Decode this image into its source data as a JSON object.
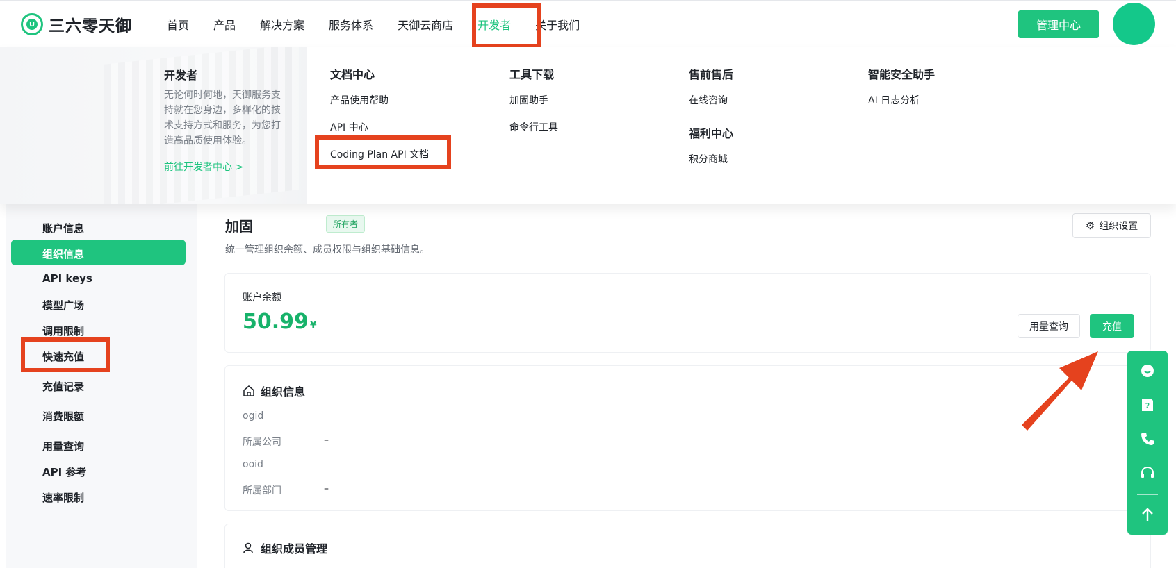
{
  "brand": {
    "name": "三六零天御"
  },
  "nav": {
    "items": [
      "首页",
      "产品",
      "解决方案",
      "服务体系",
      "天御云商店",
      "开发者",
      "关于我们"
    ],
    "active_index": 5,
    "admin_button": "管理中心"
  },
  "dropdown": {
    "intro": {
      "title": "开发者",
      "description": "无论何时何地，天御服务支持就在您身边，多样化的技术支持方式和服务，为您打造高品质使用体验。",
      "link": "前往开发者中心 >"
    },
    "columns": [
      {
        "title": "文档中心",
        "items": [
          "产品使用帮助",
          "API 中心",
          "Coding Plan API 文档"
        ]
      },
      {
        "title": "工具下载",
        "items": [
          "加固助手",
          "命令行工具"
        ]
      },
      {
        "title": "售前售后",
        "items": [
          "在线咨询"
        ],
        "sub_title": "福利中心",
        "sub_items": [
          "积分商城"
        ]
      },
      {
        "title": "智能安全助手",
        "items": [
          "AI 日志分析"
        ]
      }
    ]
  },
  "sidebar": {
    "items": [
      "账户信息",
      "组织信息",
      "API keys",
      "模型广场",
      "调用限制",
      "快速充值",
      "充值记录",
      "消费限额",
      "用量查询",
      "API 参考",
      "速率限制"
    ],
    "active_index": 1
  },
  "main": {
    "title": "加固",
    "owner_badge": "所有者",
    "subtitle": "统一管理组织余额、成员权限与组织基础信息。",
    "org_settings_button": "组织设置",
    "balance": {
      "label": "账户余额",
      "value": "50.99",
      "unit": "¥",
      "usage_button": "用量查询",
      "recharge_button": "充值"
    },
    "org_info": {
      "title": "组织信息",
      "rows": [
        {
          "label": "ogid",
          "value": ""
        },
        {
          "label": "所属公司",
          "value": "–"
        },
        {
          "label": "ooid",
          "value": ""
        },
        {
          "label": "所属部门",
          "value": "–"
        }
      ]
    },
    "members": {
      "title": "组织成员管理"
    }
  },
  "floating_tools": [
    "chat-icon",
    "help-icon",
    "phone-icon",
    "headset-icon",
    "arrow-up-icon"
  ],
  "colors": {
    "accent": "#1fc47f",
    "highlight": "#e5421e"
  }
}
